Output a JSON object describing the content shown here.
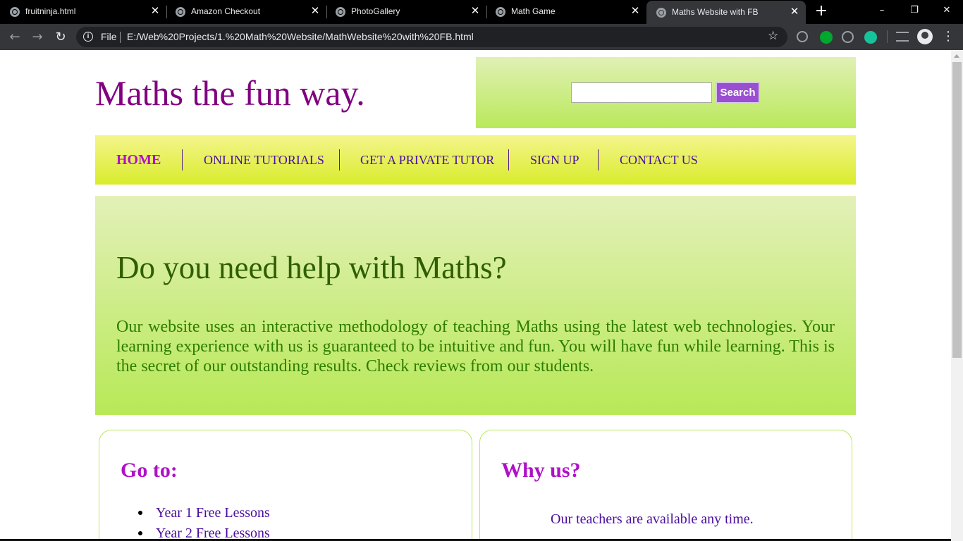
{
  "browser": {
    "tabs": [
      {
        "title": "fruitninja.html",
        "active": false
      },
      {
        "title": "Amazon Checkout",
        "active": false
      },
      {
        "title": "PhotoGallery",
        "active": false
      },
      {
        "title": "Math Game",
        "active": false
      },
      {
        "title": "Maths Website with FB",
        "active": true
      }
    ],
    "address": {
      "scheme_label": "File",
      "url": "E:/Web%20Projects/1.%20Math%20Website/MathWebsite%20with%20FB.html"
    },
    "icons": [
      "back-icon",
      "forward-icon",
      "reload-icon",
      "info-icon",
      "star-icon",
      "extension-icon",
      "evernote-icon",
      "pinterest-icon",
      "grammarly-icon",
      "media-icon",
      "avatar",
      "menu-icon"
    ],
    "colors": {
      "tabbar": "#000000",
      "toolbar": "#35363a",
      "omnibox": "#202124"
    }
  },
  "header": {
    "site_title": "Maths the fun way.",
    "search": {
      "value": "",
      "button_label": "Search"
    }
  },
  "nav": {
    "items": [
      {
        "label": "HOME",
        "active": true
      },
      {
        "label": "ONLINE TUTORIALS"
      },
      {
        "label": "GET A PRIVATE TUTOR"
      },
      {
        "label": "SIGN UP"
      },
      {
        "label": "CONTACT US"
      }
    ]
  },
  "hero": {
    "title": "Do you need help with Maths?",
    "text": "Our website uses an interactive methodology of teaching Maths using the latest web technologies. Your learning experience with us is guaranteed to be intuitive and fun. You will have fun while learning. This is the secret of our outstanding results. Check reviews from our students."
  },
  "goto": {
    "title": "Go to:",
    "links": [
      "Year 1 Free Lessons",
      "Year 2 Free Lessons"
    ]
  },
  "why": {
    "title": "Why us?",
    "text": "Our teachers are available any time."
  },
  "colors": {
    "title": "#800080",
    "nav_text": "#4b0e9e",
    "accent_purple": "#b010c8",
    "search_button": "#9a4fd1",
    "hero_text": "#2e7d00",
    "green_panel": "#b9e95a",
    "yellow_nav": "#d9ec2c"
  }
}
